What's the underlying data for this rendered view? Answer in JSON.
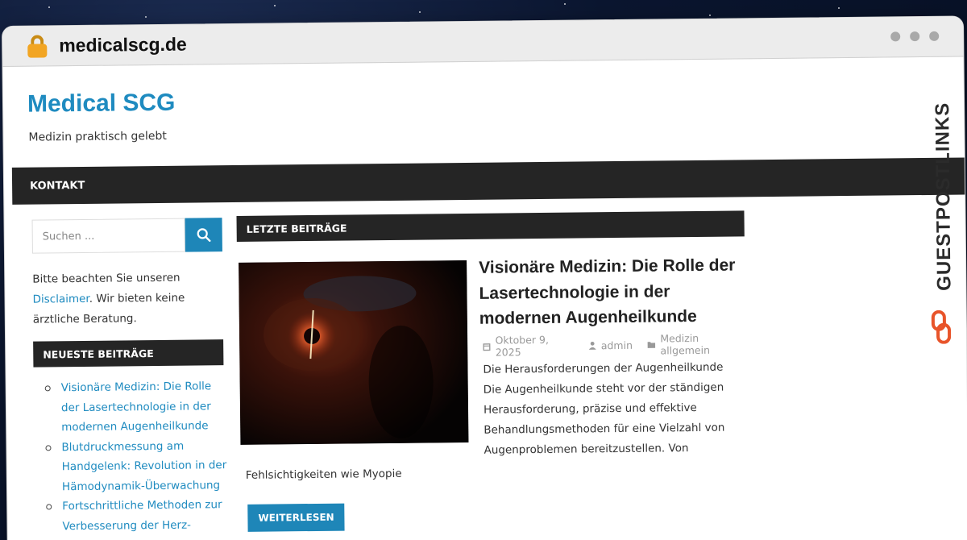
{
  "browser": {
    "url": "medicalscg.de"
  },
  "site": {
    "title": "Medical SCG",
    "tagline": "Medizin praktisch gelebt"
  },
  "nav": {
    "items": [
      {
        "label": "KONTAKT"
      }
    ]
  },
  "sidebar": {
    "search_placeholder": "Suchen ...",
    "note_before": "Bitte beachten Sie unseren ",
    "note_link": "Disclaimer",
    "note_after": ". Wir bieten keine ärztliche Beratung.",
    "recent_title": "NEUESTE BEITRÄGE",
    "recent_posts": [
      {
        "title": "Visionäre Medizin: Die Rolle der Lasertechnologie in der modernen Augenheilkunde"
      },
      {
        "title": "Blutdruckmessung am Handgelenk: Revolution in der Hämodynamik-Überwachung"
      },
      {
        "title": "Fortschrittliche Methoden zur Verbesserung der Herz-Kreislauf-"
      }
    ]
  },
  "main": {
    "section_title": "LETZTE BEITRÄGE",
    "post": {
      "title": "Visionäre Medizin: Die Rolle der Lasertechnologie in der modernen Augenheilkunde",
      "date": "Oktober 9, 2025",
      "author": "admin",
      "category": "Medizin allgemein",
      "excerpt": "Die Herausforderungen der Augenheilkunde Die Augenheilkunde steht vor der ständigen Herausforderung, präzise und effektive Behandlungsmethoden für eine Vielzahl von Augenproblemen bereitzustellen. Von",
      "excerpt_tail": "Fehlsichtigkeiten wie Myopie",
      "read_more": "WEITERLESEN"
    }
  },
  "watermark": {
    "text": "GUESTPOSTLINKS"
  },
  "colors": {
    "accent": "#1e86b8",
    "title_blue": "#1f8bc0",
    "dark_bar": "#252525"
  }
}
